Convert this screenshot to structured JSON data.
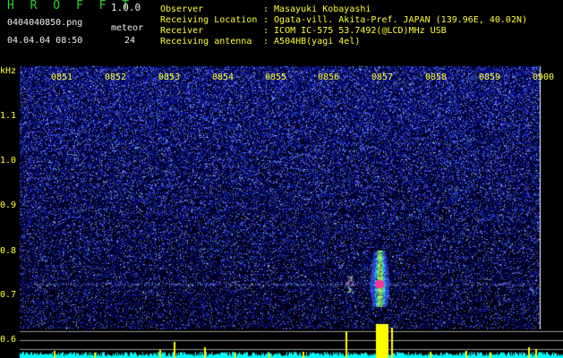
{
  "header": {
    "brand": "H R O F F T",
    "version": "1.0.0",
    "filename": "0404040850.png",
    "datetime": "04.04.04 08:50",
    "meteor_label": "meteor",
    "meteor_count": "24",
    "info_labels": [
      "Observer",
      "Receiving Location",
      "Receiver",
      "Receiving antenna"
    ],
    "info_values": [
      ": Masayuki Kobayashi",
      ": Ogata-vill. Akita-Pref. JAPAN (139.96E, 40.02N)",
      ": ICOM IC-575 53.7492(@LCD)MHz USB",
      ": A504HB(yagi 4el)"
    ]
  },
  "chart_data": {
    "type": "heatmap",
    "ylabel": "kHz",
    "x_ticks": [
      "0851",
      "0852",
      "0853",
      "0854",
      "0855",
      "0856",
      "0857",
      "0858",
      "0859",
      "0900"
    ],
    "y_ticks": [
      "1.1",
      "1.0",
      "0.9",
      "0.8",
      "0.7",
      "0.6"
    ],
    "ylim": [
      0.58,
      1.16
    ],
    "xlim": [
      8.83,
      9.0
    ],
    "carrier_line_khz": 0.725,
    "main_echo": {
      "time": "0857",
      "freq_khz": 0.725,
      "span_khz": [
        0.675,
        0.8
      ]
    },
    "secondary_echo": {
      "time": "0856.5",
      "freq_khz": 0.725
    }
  },
  "colors": {
    "background": "#000000",
    "noise_deep": "#00008c",
    "noise_mid": "#2633d9",
    "noise_bright": "#7f9bff",
    "echo_core": "#ff3399",
    "signal_level": "#ffff00",
    "noise_floor": "#00ffff",
    "grid": "#9a9a9a"
  }
}
